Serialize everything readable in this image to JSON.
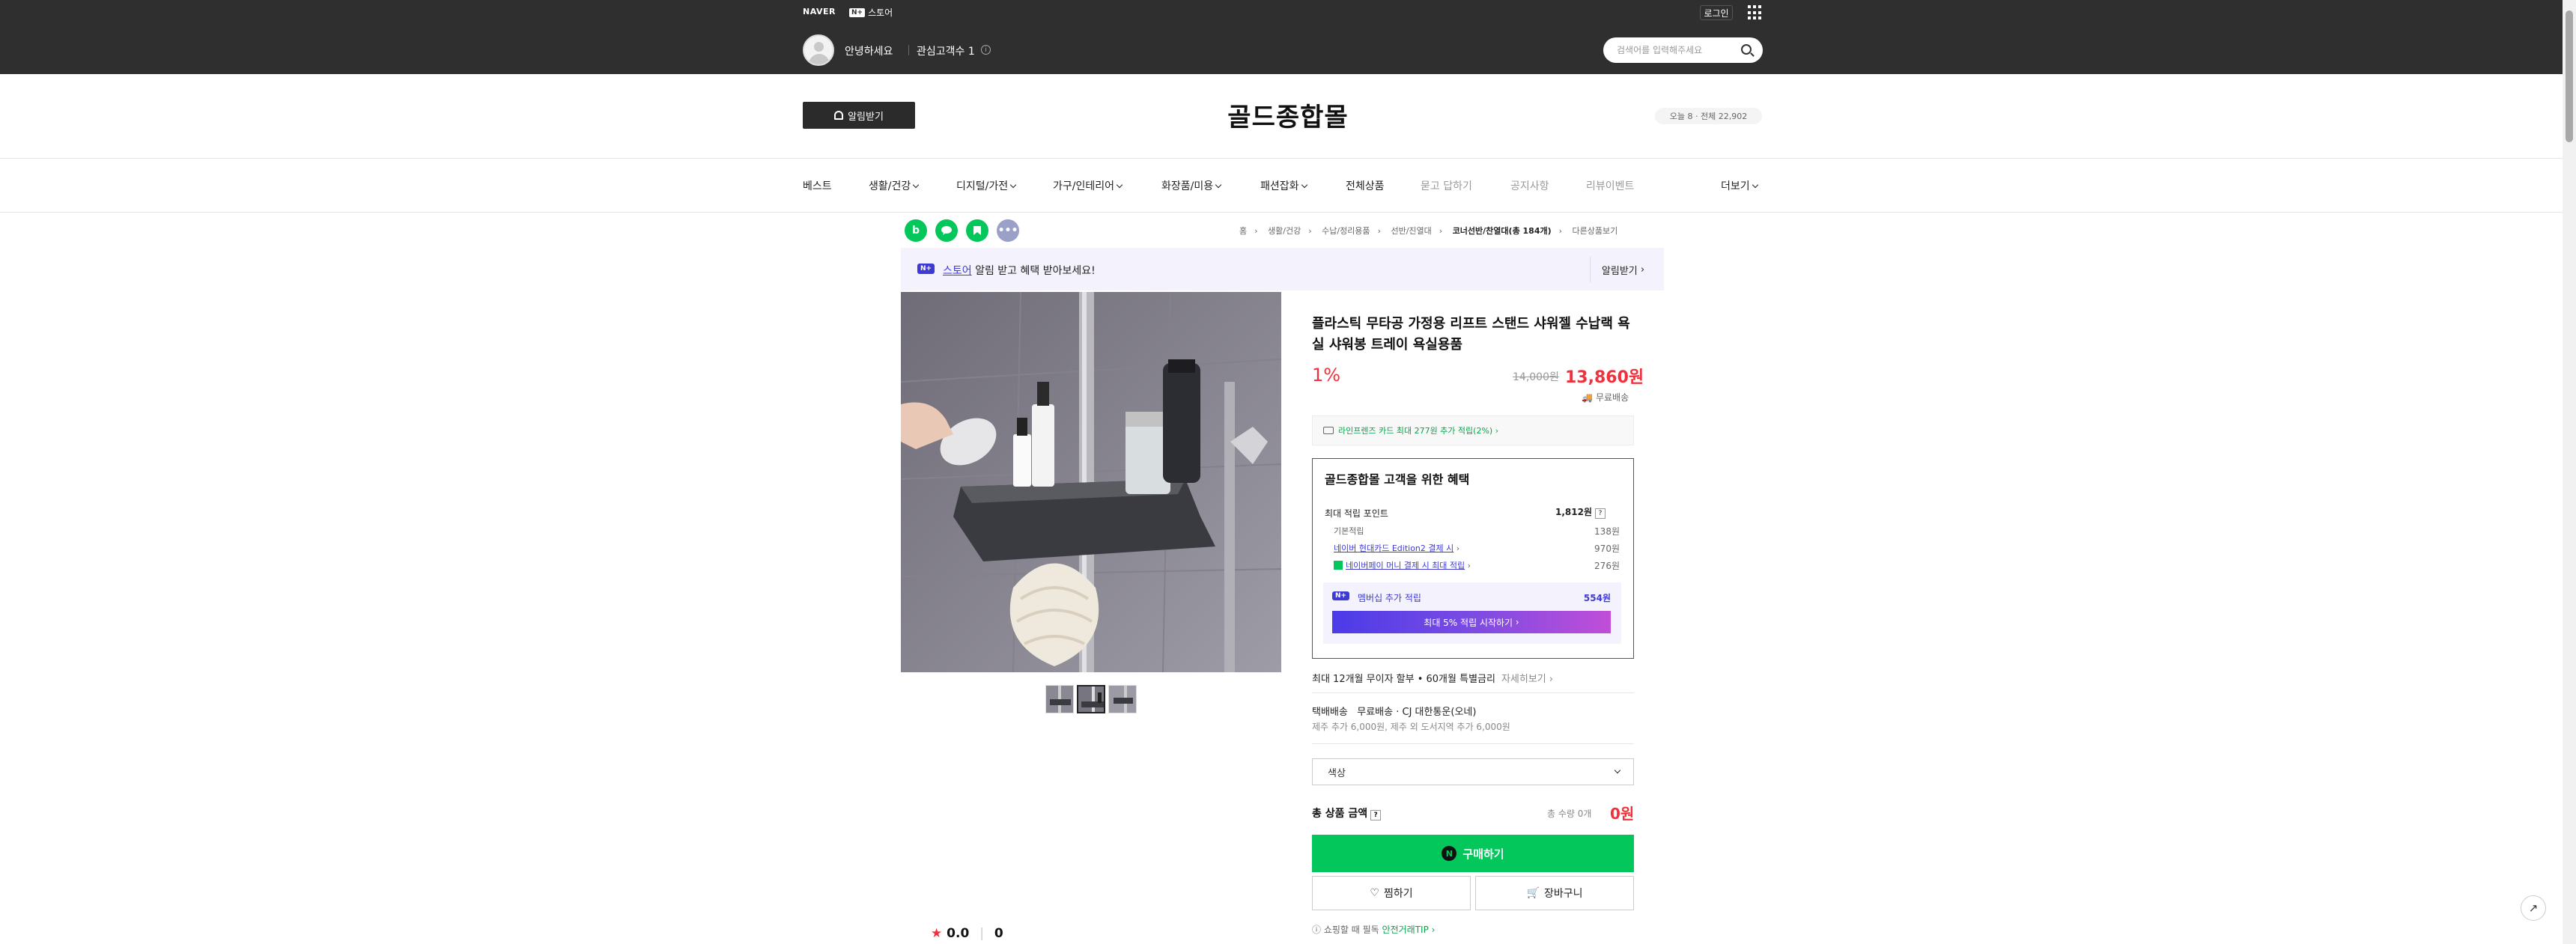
{
  "topbar": {
    "naver": "NAVER",
    "store_chip": "N+",
    "store": "스토어",
    "login": "로그인",
    "hello": "안녕하세요",
    "interest": "관심고객수 1",
    "search_placeholder": "검색어를 입력해주세요"
  },
  "header": {
    "alarm_label": "알림받기",
    "store_name": "골드종합몰",
    "visitors": "오늘 8 · 전체 22,902"
  },
  "nav": {
    "items": [
      {
        "label": "베스트",
        "dropdown": false,
        "muted": false
      },
      {
        "label": "생활/건강",
        "dropdown": true,
        "muted": false
      },
      {
        "label": "디지털/가전",
        "dropdown": true,
        "muted": false
      },
      {
        "label": "가구/인테리어",
        "dropdown": true,
        "muted": false
      },
      {
        "label": "화장품/미용",
        "dropdown": true,
        "muted": false
      },
      {
        "label": "패션잡화",
        "dropdown": true,
        "muted": false
      },
      {
        "label": "전체상품",
        "dropdown": false,
        "muted": false
      },
      {
        "label": "묻고 답하기",
        "dropdown": false,
        "muted": true
      },
      {
        "label": "공지사항",
        "dropdown": false,
        "muted": true
      },
      {
        "label": "리뷰이벤트",
        "dropdown": false,
        "muted": true
      }
    ],
    "more": "더보기"
  },
  "breadcrumb": {
    "items": [
      "홈",
      "생활/건강",
      "수납/정리용품",
      "선반/진열대",
      "코너선반/찬열대(총 184개)",
      "다른상품보기"
    ]
  },
  "banner": {
    "chip": "N+",
    "store_link": "스토어",
    "text": " 알림 받고 혜택 받아보세요!",
    "button": "알림받기"
  },
  "product": {
    "title": "플라스틱 무타공 가정용 리프트 스탠드 샤워젤 수납랙 욕실 샤워봉 트레이 욕실용품",
    "discount": "1%",
    "original_price": "14,000원",
    "price": "13,860원",
    "shipping": "무료배송",
    "card_benefit": "라인프렌즈 카드 최대 277원 추가 적립(2%)"
  },
  "benefit": {
    "title": "골드종합몰 고객을 위한 혜택",
    "max_point_label": "최대 적립 포인트",
    "max_point": "1,812원",
    "rows": [
      {
        "label": "기본적립",
        "amount": "138원",
        "link": false
      },
      {
        "label": "네이버 현대카드 Edition2 결제 시",
        "amount": "970원",
        "link": true
      },
      {
        "label": "네이버페이 머니 결제 시 최대 적립",
        "amount": "276원",
        "link": true
      }
    ],
    "membership_label": "멤버십 추가 적립",
    "membership_amount": "554원",
    "membership_button": "최대 5% 적립 시작하기"
  },
  "installment": {
    "text": "최대 12개월 무이자 할부 • 60개월 특별금리",
    "more": "자세히보기"
  },
  "delivery": {
    "label": "택배배송",
    "info": "무료배송 · CJ 대한통운(오네)",
    "extra": "제주 추가 6,000원, 제주 외 도서지역 추가 6,000원"
  },
  "option": {
    "placeholder": "색상"
  },
  "total": {
    "label": "총 상품 금액",
    "qty": "총 수량 0개",
    "price": "0원"
  },
  "actions": {
    "buy": "구매하기",
    "npay": "N",
    "wish": "찜하기",
    "cart": "장바구니"
  },
  "tips": {
    "prefix": "쇼핑할 때 필독",
    "link": "안전거래TIP"
  },
  "rating": {
    "score": "0.0",
    "count": "0"
  },
  "colors": {
    "accent_green": "#03c75a",
    "price_red": "#f2303b",
    "membership_purple": "#3d3bd4"
  }
}
